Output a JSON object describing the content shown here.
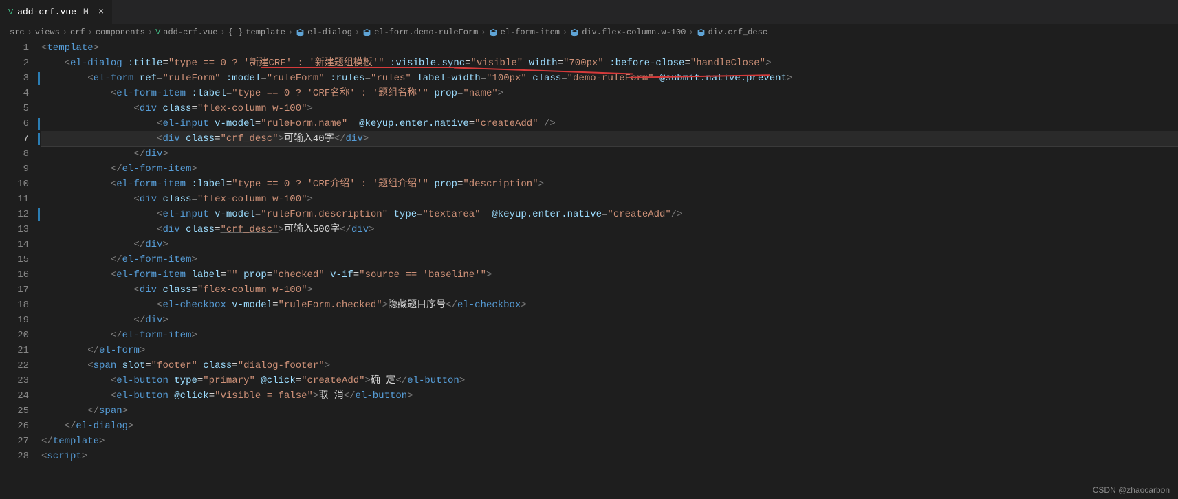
{
  "tab": {
    "icon": "V",
    "filename": "add-crf.vue",
    "modified": "M",
    "close": "×"
  },
  "breadcrumb": {
    "items": [
      "src",
      "views",
      "crf",
      "components",
      "add-crf.vue",
      "template",
      "el-dialog",
      "el-form.demo-ruleForm",
      "el-form-item",
      "div.flex-column.w-100",
      "div.crf_desc"
    ],
    "sep": "›",
    "vue_icon": "V",
    "brace_icon": "{ }"
  },
  "lines": {
    "count": 28,
    "active": 7,
    "modified": [
      3,
      6,
      7,
      12
    ]
  },
  "code": {
    "l1": {
      "a": "<",
      "b": "template",
      "c": ">"
    },
    "l2": {
      "a": "<",
      "b": "el-dialog",
      "sp": " ",
      "at1": ":title",
      "eq": "=",
      "st1": "\"type == 0 ? '新建CRF' : '新建题组模板'\"",
      "at2": ":visible.sync",
      "st2": "\"visible\"",
      "at3": "width",
      "st3": "\"700px\"",
      "at4": ":before-close",
      "st4": "\"handleClose\"",
      "c": ">"
    },
    "l3": {
      "a": "<",
      "b": "el-form",
      "at1": "ref",
      "st1": "\"ruleForm\"",
      "at2": ":model",
      "st2": "\"ruleForm\"",
      "at3": ":rules",
      "st3": "\"rules\"",
      "at4": "label-width",
      "st4": "\"100px\"",
      "at5": "class",
      "st5": "\"demo-ruleForm\"",
      "at6": "@submit.native.prevent",
      "c": ">"
    },
    "l4": {
      "a": "<",
      "b": "el-form-item",
      "at1": ":label",
      "st1": "\"type == 0 ? 'CRF名称' : '题组名称'\"",
      "at2": "prop",
      "st2": "\"name\"",
      "c": ">"
    },
    "l5": {
      "a": "<",
      "b": "div",
      "at1": "class",
      "st1": "\"flex-column w-100\"",
      "c": ">"
    },
    "l6": {
      "a": "<",
      "b": "el-input",
      "at1": "v-model",
      "st1": "\"ruleForm.name\"",
      "at2": "@keyup.enter.native",
      "st2": "\"createAdd\"",
      "c": " />"
    },
    "l7": {
      "a": "<",
      "b": "div",
      "at1": "class",
      "st1": "\"crf_desc\"",
      "c": ">",
      "tx": "可输入40字",
      "d": "</",
      "e": "div",
      "f": ">"
    },
    "l8": {
      "a": "</",
      "b": "div",
      "c": ">"
    },
    "l9": {
      "a": "</",
      "b": "el-form-item",
      "c": ">"
    },
    "l10": {
      "a": "<",
      "b": "el-form-item",
      "at1": ":label",
      "st1": "\"type == 0 ? 'CRF介绍' : '题组介绍'\"",
      "at2": "prop",
      "st2": "\"description\"",
      "c": ">"
    },
    "l11": {
      "a": "<",
      "b": "div",
      "at1": "class",
      "st1": "\"flex-column w-100\"",
      "c": ">"
    },
    "l12": {
      "a": "<",
      "b": "el-input",
      "at1": "v-model",
      "st1": "\"ruleForm.description\"",
      "at2": "type",
      "st2": "\"textarea\"",
      "at3": "@keyup.enter.native",
      "st3": "\"createAdd\"",
      "c": "/>"
    },
    "l13": {
      "a": "<",
      "b": "div",
      "at1": "class",
      "st1": "\"crf_desc\"",
      "c": ">",
      "tx": "可输入500字",
      "d": "</",
      "e": "div",
      "f": ">"
    },
    "l14": {
      "a": "</",
      "b": "div",
      "c": ">"
    },
    "l15": {
      "a": "</",
      "b": "el-form-item",
      "c": ">"
    },
    "l16": {
      "a": "<",
      "b": "el-form-item",
      "at1": "label",
      "st1": "\"\"",
      "at2": "prop",
      "st2": "\"checked\"",
      "at3": "v-if",
      "st3": "\"source == 'baseline'\"",
      "c": ">"
    },
    "l17": {
      "a": "<",
      "b": "div",
      "at1": "class",
      "st1": "\"flex-column w-100\"",
      "c": ">"
    },
    "l18": {
      "a": "<",
      "b": "el-checkbox",
      "at1": "v-model",
      "st1": "\"ruleForm.checked\"",
      "c": ">",
      "tx": "隐藏题目序号",
      "d": "</",
      "e": "el-checkbox",
      "f": ">"
    },
    "l19": {
      "a": "</",
      "b": "div",
      "c": ">"
    },
    "l20": {
      "a": "</",
      "b": "el-form-item",
      "c": ">"
    },
    "l21": {
      "a": "</",
      "b": "el-form",
      "c": ">"
    },
    "l22": {
      "a": "<",
      "b": "span",
      "at1": "slot",
      "st1": "\"footer\"",
      "at2": "class",
      "st2": "\"dialog-footer\"",
      "c": ">"
    },
    "l23": {
      "a": "<",
      "b": "el-button",
      "at1": "type",
      "st1": "\"primary\"",
      "at2": "@click",
      "st2": "\"createAdd\"",
      "c": ">",
      "tx": "确 定",
      "d": "</",
      "e": "el-button",
      "f": ">"
    },
    "l24": {
      "a": "<",
      "b": "el-button",
      "at1": "@click",
      "st1": "\"visible = false\"",
      "c": ">",
      "tx": "取 消",
      "d": "</",
      "e": "el-button",
      "f": ">"
    },
    "l25": {
      "a": "</",
      "b": "span",
      "c": ">"
    },
    "l26": {
      "a": "</",
      "b": "el-dialog",
      "c": ">"
    },
    "l27": {
      "a": "</",
      "b": "template",
      "c": ">"
    },
    "l28": {
      "a": "<",
      "b": "script",
      "c": ">"
    }
  },
  "watermark": "CSDN @zhaocarbon"
}
